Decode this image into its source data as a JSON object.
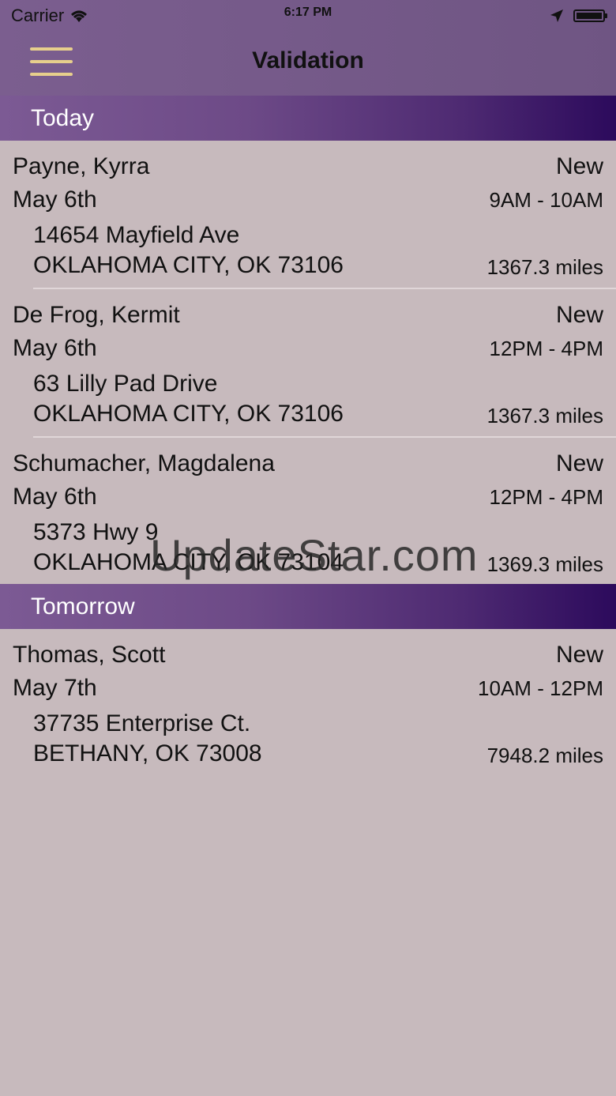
{
  "status_bar": {
    "carrier": "Carrier",
    "time": "6:17 PM"
  },
  "header": {
    "title": "Validation"
  },
  "sections": [
    {
      "label": "Today",
      "items": [
        {
          "name": "Payne, Kyrra",
          "status": "New",
          "date": "May 6th",
          "time": "9AM - 10AM",
          "street": "14654 Mayfield Ave",
          "city": "OKLAHOMA CITY, OK 73106",
          "distance": "1367.3 miles"
        },
        {
          "name": "De Frog, Kermit",
          "status": "New",
          "date": "May 6th",
          "time": "12PM - 4PM",
          "street": "63 Lilly Pad Drive",
          "city": "OKLAHOMA CITY, OK 73106",
          "distance": "1367.3 miles"
        },
        {
          "name": "Schumacher, Magdalena",
          "status": "New",
          "date": "May 6th",
          "time": "12PM - 4PM",
          "street": "5373 Hwy 9",
          "city": "OKLAHOMA CITY, OK 73104",
          "distance": "1369.3 miles"
        }
      ]
    },
    {
      "label": "Tomorrow",
      "items": [
        {
          "name": "Thomas, Scott",
          "status": "New",
          "date": "May 7th",
          "time": "10AM - 12PM",
          "street": "37735 Enterprise Ct.",
          "city": "BETHANY, OK 73008",
          "distance": "7948.2 miles"
        }
      ]
    }
  ],
  "watermark": "UpdateStar.com",
  "colors": {
    "accent": "#e7cf8c",
    "header": "#7b5e8f",
    "section_end": "#2c0a5c",
    "background": "#c7babd"
  }
}
